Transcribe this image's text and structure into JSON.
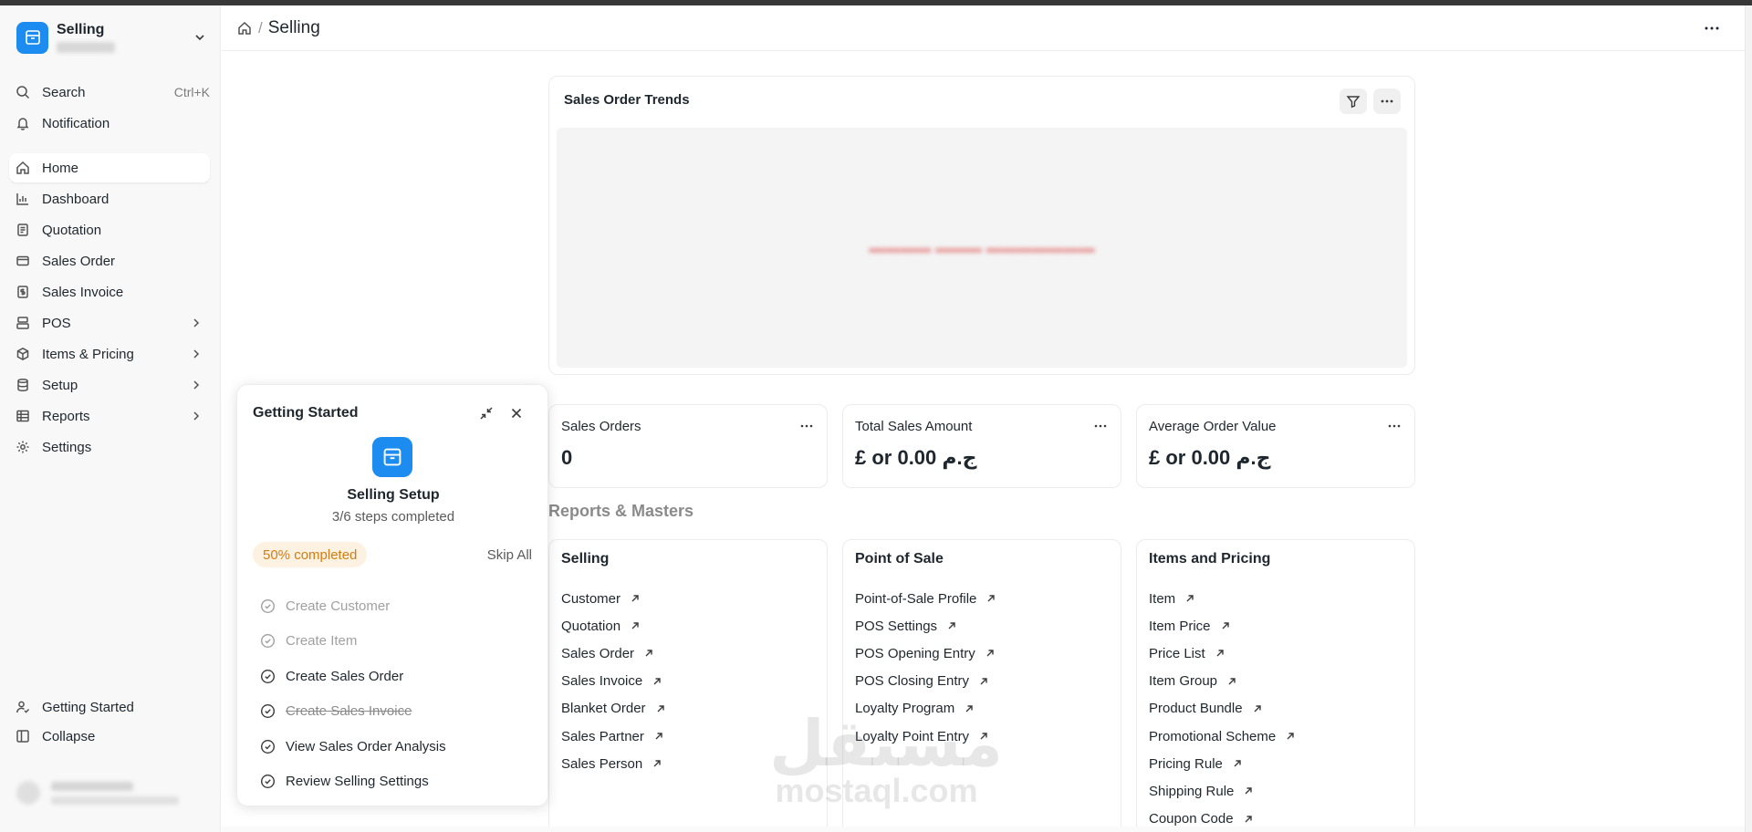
{
  "app": {
    "name": "Selling"
  },
  "sidebar": {
    "search_label": "Search",
    "search_shortcut": "Ctrl+K",
    "notification_label": "Notification",
    "items": [
      {
        "label": "Home",
        "icon": "home-icon",
        "active": true
      },
      {
        "label": "Dashboard",
        "icon": "chart-icon"
      },
      {
        "label": "Quotation",
        "icon": "document-icon"
      },
      {
        "label": "Sales Order",
        "icon": "card-icon"
      },
      {
        "label": "Sales Invoice",
        "icon": "invoice-icon"
      },
      {
        "label": "POS",
        "icon": "pos-icon",
        "expandable": true
      },
      {
        "label": "Items & Pricing",
        "icon": "package-icon",
        "expandable": true
      },
      {
        "label": "Setup",
        "icon": "database-icon",
        "expandable": true
      },
      {
        "label": "Reports",
        "icon": "table-icon",
        "expandable": true
      },
      {
        "label": "Settings",
        "icon": "gear-icon"
      }
    ],
    "getting_started_label": "Getting Started",
    "collapse_label": "Collapse"
  },
  "header": {
    "breadcrumb_current": "Selling",
    "breadcrumb_sep": "/"
  },
  "chart_card": {
    "title": "Sales Order Trends"
  },
  "stats": [
    {
      "title": "Sales Orders",
      "value": "0"
    },
    {
      "title": "Total Sales Amount",
      "value": "£ or 0.00 ج.م"
    },
    {
      "title": "Average Order Value",
      "value": "£ or 0.00 ج.م"
    }
  ],
  "reports_section": {
    "title": "Reports & Masters",
    "cards": [
      {
        "title": "Selling",
        "links": [
          "Customer",
          "Quotation",
          "Sales Order",
          "Sales Invoice",
          "Blanket Order",
          "Sales Partner",
          "Sales Person"
        ]
      },
      {
        "title": "Point of Sale",
        "links": [
          "Point-of-Sale Profile",
          "POS Settings",
          "POS Opening Entry",
          "POS Closing Entry",
          "Loyalty Program",
          "Loyalty Point Entry"
        ]
      },
      {
        "title": "Items and Pricing",
        "links": [
          "Item",
          "Item Price",
          "Price List",
          "Item Group",
          "Product Bundle",
          "Promotional Scheme",
          "Pricing Rule",
          "Shipping Rule",
          "Coupon Code"
        ]
      }
    ]
  },
  "getting_started": {
    "title": "Getting Started",
    "setup_name": "Selling Setup",
    "steps_text": "3/6 steps completed",
    "progress_badge": "50% completed",
    "progress_fraction": 0.5,
    "skip_label": "Skip All",
    "steps": [
      {
        "label": "Create Customer",
        "state": "done"
      },
      {
        "label": "Create Item",
        "state": "done"
      },
      {
        "label": "Create Sales Order",
        "state": "todo"
      },
      {
        "label": "Create Sales Invoice",
        "state": "skipped"
      },
      {
        "label": "View Sales Order Analysis",
        "state": "todo"
      },
      {
        "label": "Review Selling Settings",
        "state": "todo"
      }
    ]
  },
  "watermark": {
    "arabic": "مستقل",
    "latin": "mostaql.com"
  },
  "colors": {
    "accent": "#1c8cf0",
    "badge_bg": "#fdf1e1",
    "badge_text": "#d27d14"
  }
}
